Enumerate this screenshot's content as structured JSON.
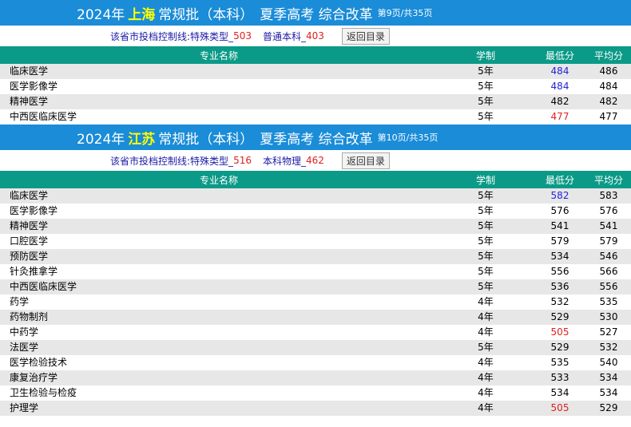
{
  "headers": {
    "major": "专业名称",
    "years": "学制",
    "min": "最低分",
    "avg": "平均分"
  },
  "back_label": "返回目录",
  "sections": [
    {
      "year": "2024年",
      "province": "上海",
      "batch": "常规批（本科）",
      "exam": "夏季高考 综合改革",
      "page": "第9页/共35页",
      "ctrl_label": "该省市投档控制线:",
      "ctrl1_label": "特殊类型_",
      "ctrl1_value": "503",
      "ctrl2_label": "普通本科_",
      "ctrl2_value": "403",
      "rows": [
        {
          "name": "临床医学",
          "years": "5年",
          "min": "484",
          "avg": "486",
          "min_color": "blue"
        },
        {
          "name": "医学影像学",
          "years": "5年",
          "min": "484",
          "avg": "484",
          "min_color": "blue"
        },
        {
          "name": "精神医学",
          "years": "5年",
          "min": "482",
          "avg": "482",
          "min_color": ""
        },
        {
          "name": "中西医临床医学",
          "years": "5年",
          "min": "477",
          "avg": "477",
          "min_color": "red"
        }
      ]
    },
    {
      "year": "2024年",
      "province": "江苏",
      "batch": "常规批（本科）",
      "exam": "夏季高考 综合改革",
      "page": "第10页/共35页",
      "ctrl_label": "该省市投档控制线:",
      "ctrl1_label": "特殊类型_",
      "ctrl1_value": "516",
      "ctrl2_label": "本科物理_",
      "ctrl2_value": "462",
      "rows": [
        {
          "name": "临床医学",
          "years": "5年",
          "min": "582",
          "avg": "583",
          "min_color": "blue"
        },
        {
          "name": "医学影像学",
          "years": "5年",
          "min": "576",
          "avg": "576",
          "min_color": ""
        },
        {
          "name": "精神医学",
          "years": "5年",
          "min": "541",
          "avg": "541",
          "min_color": ""
        },
        {
          "name": "口腔医学",
          "years": "5年",
          "min": "579",
          "avg": "579",
          "min_color": ""
        },
        {
          "name": "预防医学",
          "years": "5年",
          "min": "534",
          "avg": "546",
          "min_color": ""
        },
        {
          "name": "针灸推拿学",
          "years": "5年",
          "min": "556",
          "avg": "566",
          "min_color": ""
        },
        {
          "name": "中西医临床医学",
          "years": "5年",
          "min": "536",
          "avg": "556",
          "min_color": ""
        },
        {
          "name": "药学",
          "years": "4年",
          "min": "532",
          "avg": "535",
          "min_color": ""
        },
        {
          "name": "药物制剂",
          "years": "4年",
          "min": "529",
          "avg": "530",
          "min_color": ""
        },
        {
          "name": "中药学",
          "years": "4年",
          "min": "505",
          "avg": "527",
          "min_color": "red"
        },
        {
          "name": "法医学",
          "years": "5年",
          "min": "529",
          "avg": "532",
          "min_color": ""
        },
        {
          "name": "医学检验技术",
          "years": "4年",
          "min": "535",
          "avg": "540",
          "min_color": ""
        },
        {
          "name": "康复治疗学",
          "years": "4年",
          "min": "533",
          "avg": "534",
          "min_color": ""
        },
        {
          "name": "卫生检验与检疫",
          "years": "4年",
          "min": "534",
          "avg": "534",
          "min_color": ""
        },
        {
          "name": "护理学",
          "years": "4年",
          "min": "505",
          "avg": "529",
          "min_color": "red"
        }
      ]
    }
  ]
}
